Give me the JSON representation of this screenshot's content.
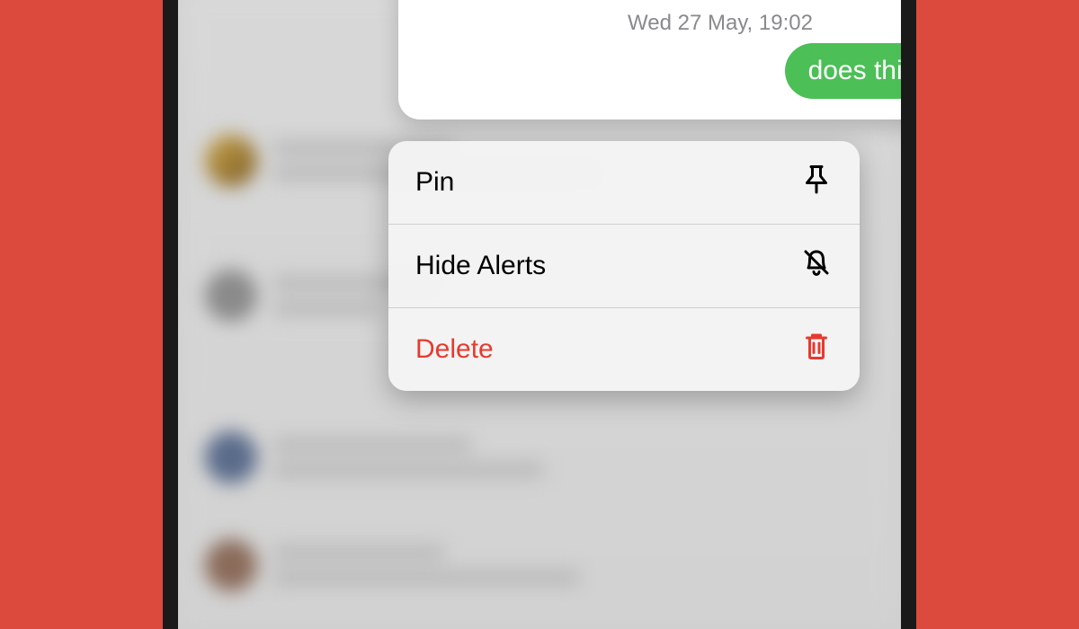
{
  "message": {
    "timestamp": "Wed 27 May, 19:02",
    "bubble_text": "does this work?"
  },
  "context_menu": {
    "pin_label": "Pin",
    "hide_alerts_label": "Hide Alerts",
    "delete_label": "Delete"
  },
  "colors": {
    "accent_red": "#DC4A3E",
    "bubble_green": "#4CBF57",
    "destructive": "#E8392E"
  }
}
